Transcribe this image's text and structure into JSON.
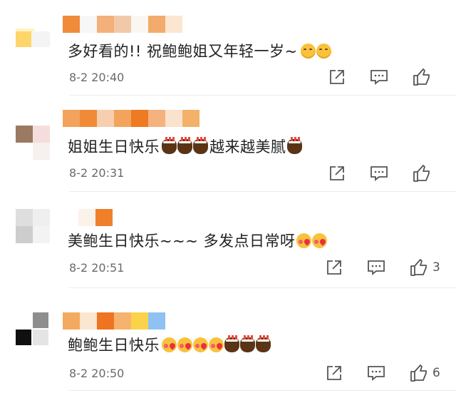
{
  "comments": [
    {
      "text": "多好看的!! 祝鲍鲍姐又年轻一岁~",
      "emojis": [
        "smile-emoji",
        "smile-emoji"
      ],
      "time": "8-2 20:40",
      "likes": "",
      "name_colors": [
        "#f08b3a",
        "#f5f5f5",
        "#f3b07a",
        "#f2c9a8",
        "#faf7f3",
        "#f2ab6c",
        "#fbe6d2"
      ],
      "avatar_colors": [
        "#fff3c6",
        "#fdd66b"
      ]
    },
    {
      "text": "姐姐生日快乐",
      "text2": "越来越美腻",
      "emojis": [
        "cake-emoji",
        "cake-emoji",
        "cake-emoji"
      ],
      "emoji_end": [
        "cake-emoji"
      ],
      "time": "8-2 20:31",
      "likes": "",
      "name_colors": [
        "#f3a35e",
        "#f08a37",
        "#f7cfae",
        "#f3a45c",
        "#ee7a21",
        "#f4b27e",
        "#f9e3cc",
        "#f4b16a"
      ],
      "avatar_colors": [
        "#9a7a62",
        "#e8d9cf",
        "#f2d9d8"
      ]
    },
    {
      "text": "美鲍生日快乐~~~ 多发点日常呀",
      "emojis": [
        "kiss-emoji",
        "kiss-emoji"
      ],
      "time": "8-2 20:51",
      "likes": "3",
      "name_colors": [
        "#fbf2ea",
        "#ee7f2b"
      ],
      "avatar_colors": [
        "#dcdcdc",
        "#c8c8c8",
        "#eeeeee"
      ]
    },
    {
      "text": "鲍鲍生日快乐",
      "emojis": [
        "kiss-emoji",
        "kiss-emoji",
        "kiss-emoji",
        "kiss-emoji",
        "cake-emoji",
        "cake-emoji",
        "cake-emoji"
      ],
      "time": "8-2 20:50",
      "likes": "6",
      "name_colors": [
        "#f4a960",
        "#fbe6d0",
        "#ee7421",
        "#f6b36d",
        "#fad34a",
        "#8fc2f3"
      ],
      "avatar_colors": [
        "#8e8e8e",
        "#101010",
        "#d8d8d8"
      ]
    }
  ],
  "icons": [
    "share-icon",
    "comment-icon",
    "like-icon"
  ]
}
